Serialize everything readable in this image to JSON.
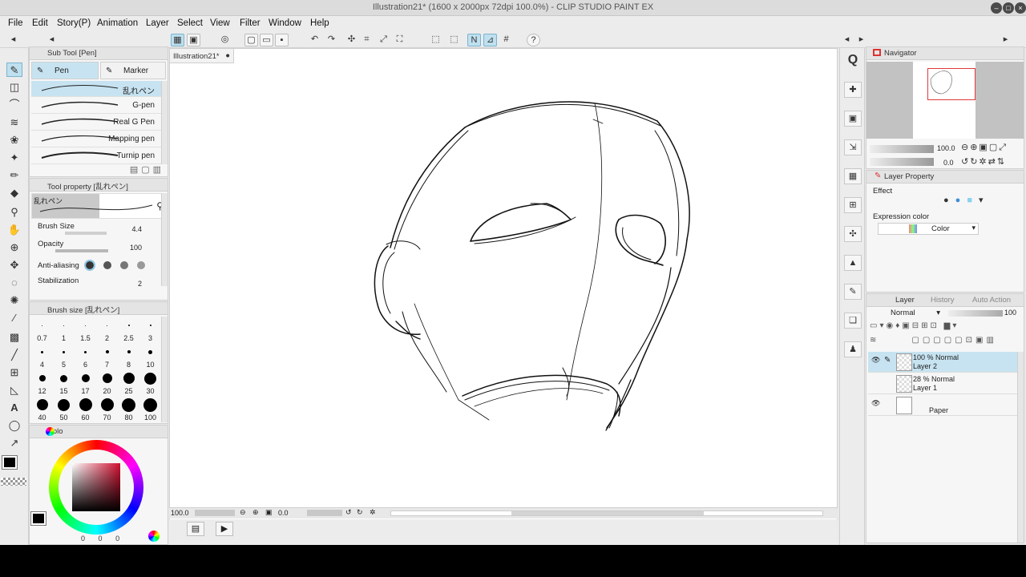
{
  "window": {
    "title": "Illustration21* (1600 x 2000px 72dpi 100.0%) - CLIP STUDIO PAINT EX",
    "min_label": "–",
    "max_label": "□",
    "close_label": "×"
  },
  "menu": [
    "File",
    "Edit",
    "Story(P)",
    "Animation",
    "Layer",
    "Select",
    "View",
    "Filter",
    "Window",
    "Help"
  ],
  "subtool": {
    "title": "Sub Tool [Pen]",
    "tabs": [
      "Pen",
      "Marker"
    ],
    "brushes": [
      "乱れペン",
      "G-pen",
      "Real G Pen",
      "Mapping pen",
      "Turnip pen"
    ]
  },
  "tool_property": {
    "title": "Tool property [乱れペン]",
    "brush_name": "乱れペン",
    "brush_size_label": "Brush Size",
    "brush_size_value": "4.4",
    "opacity_label": "Opacity",
    "opacity_value": "100",
    "antialias_label": "Anti-aliasing",
    "stabilization_label": "Stabilization",
    "stabilization_value": "2"
  },
  "brush_size_panel": {
    "title": "Brush size [乱れペン]",
    "rows": [
      [
        "0.7",
        "1",
        "1.5",
        "2",
        "2.5",
        "3"
      ],
      [
        "4",
        "5",
        "6",
        "7",
        "8",
        "10"
      ],
      [
        "12",
        "15",
        "17",
        "20",
        "25",
        "30"
      ],
      [
        "40",
        "50",
        "60",
        "70",
        "80",
        "100"
      ]
    ]
  },
  "color_panel": {
    "tab_label": "Colo",
    "main_color": "#000000",
    "value_1": "0",
    "value_2": "0",
    "value_3": "0"
  },
  "document": {
    "tab_label": "Illustration21*",
    "zoom": "100.0",
    "angle": "0.0"
  },
  "navigator": {
    "title": "Navigator",
    "zoom": "100.0",
    "angle": "0.0"
  },
  "layer_property": {
    "title": "Layer Property",
    "effect_label": "Effect",
    "expression_color_label": "Expression color",
    "expression_color_value": "Color"
  },
  "layer_panel": {
    "tabs": [
      "Layer",
      "History",
      "Auto Action"
    ],
    "blend_mode": "Normal",
    "opacity": "100",
    "layers": [
      {
        "line1": "100 % Normal",
        "line2": "Layer 2",
        "selected": true,
        "visible": true
      },
      {
        "line1": "28 % Normal",
        "line2": "Layer 1",
        "selected": false,
        "visible": false
      },
      {
        "line1": "",
        "line2": "Paper",
        "selected": false,
        "visible": true
      }
    ]
  },
  "colors": {
    "accent": "#c7e3f1",
    "panel_bg": "#f6f6f6",
    "chrome": "#ececec"
  }
}
